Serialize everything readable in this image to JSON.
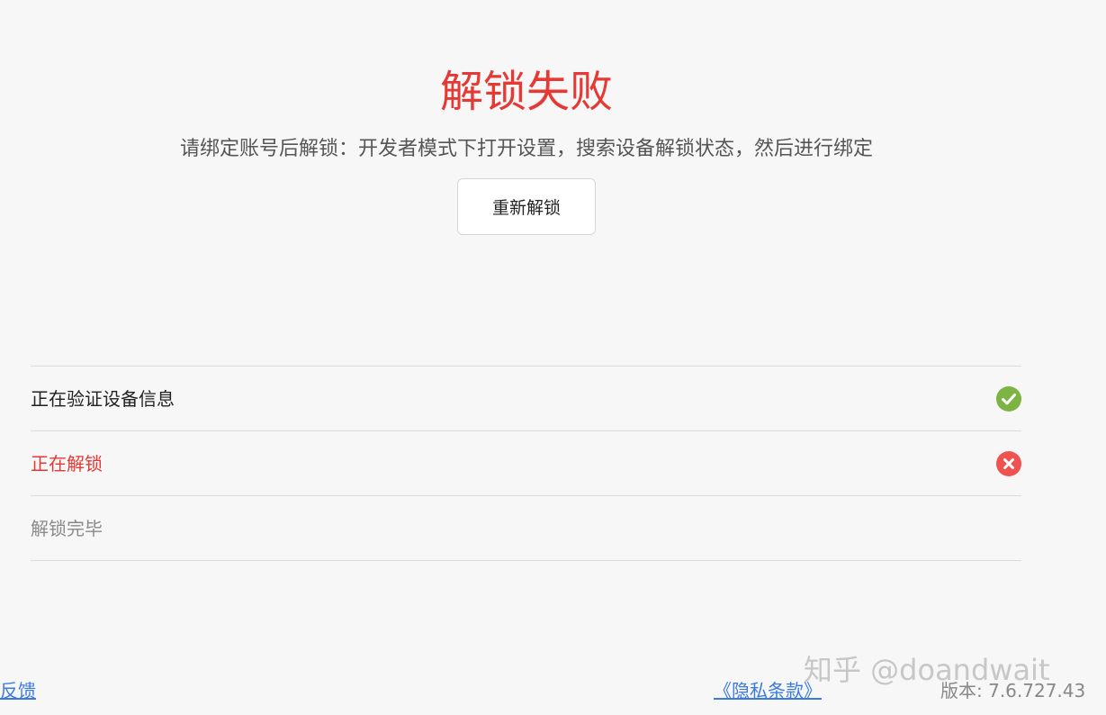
{
  "header": {
    "title": "解锁失败",
    "message": "请绑定账号后解锁：开发者模式下打开设置，搜索设备解锁状态，然后进行绑定"
  },
  "actions": {
    "retry_label": "重新解锁"
  },
  "steps": [
    {
      "label": "正在验证设备信息",
      "status": "success",
      "icon": "check-circle-icon",
      "color": "#7cb342"
    },
    {
      "label": "正在解锁",
      "status": "failed",
      "icon": "error-circle-icon",
      "color": "#ef5350"
    },
    {
      "label": "解锁完毕",
      "status": "pending"
    }
  ],
  "footer": {
    "feedback_label": "见反馈",
    "privacy_label": "《隐私条款》",
    "version": "版本: 7.6.727.43"
  },
  "watermark": "知乎 @doandwait",
  "colors": {
    "error": "#e53935",
    "success": "#7cb342",
    "link": "#3b7be0",
    "background": "#f7f7f7"
  }
}
